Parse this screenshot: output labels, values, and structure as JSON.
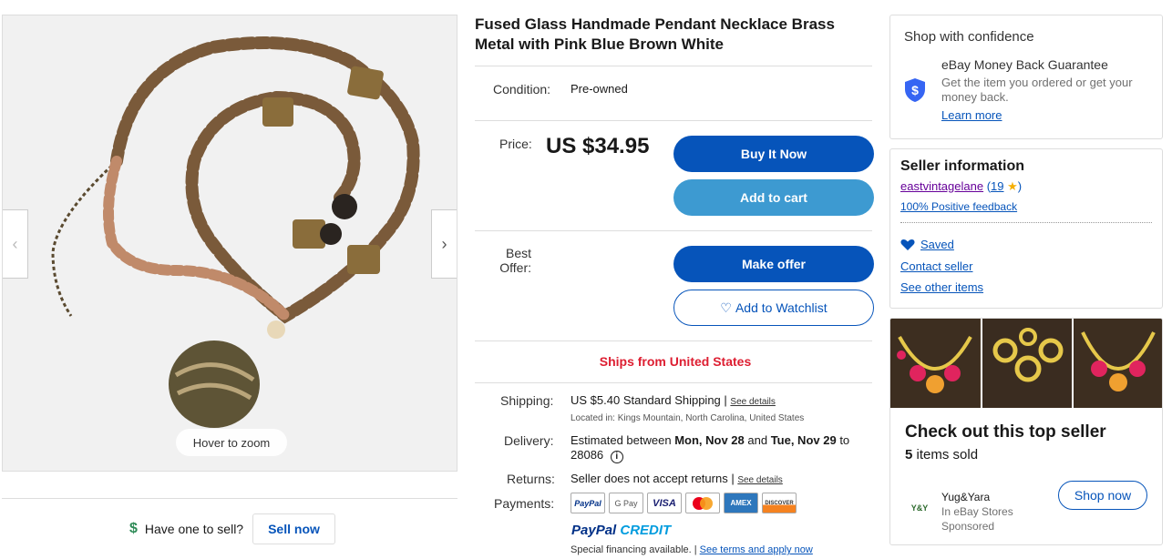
{
  "gallery": {
    "zoom_hint": "Hover to zoom",
    "prev_icon": "chevron-left-icon",
    "next_icon": "chevron-right-icon"
  },
  "sell": {
    "icon": "dollar-icon",
    "prompt": "Have one to sell?",
    "button": "Sell now"
  },
  "listing": {
    "title": "Fused Glass Handmade Pendant Necklace Brass Metal with Pink Blue Brown White",
    "condition_label": "Condition:",
    "condition_value": "Pre-owned",
    "price_label": "Price:",
    "price_value": "US $34.95",
    "buy_now": "Buy It Now",
    "add_to_cart": "Add to cart",
    "best_offer_label_1": "Best",
    "best_offer_label_2": "Offer:",
    "make_offer": "Make offer",
    "add_to_watchlist": "Add to Watchlist",
    "ships_from": "Ships from United States",
    "shipping_label": "Shipping:",
    "shipping_value": "US $5.40 Standard Shipping",
    "shipping_sep": " | ",
    "see_details": "See details",
    "location": "Located in: Kings Mountain, North Carolina, United States",
    "delivery_label": "Delivery:",
    "delivery_prefix": "Estimated between ",
    "delivery_start": "Mon, Nov 28",
    "delivery_and": " and ",
    "delivery_end": "Tue, Nov 29",
    "delivery_to": " to",
    "delivery_zip": "28086",
    "returns_label": "Returns:",
    "returns_value": "Seller does not accept returns",
    "returns_sep": " | ",
    "returns_details": "See details",
    "payments_label": "Payments:",
    "payment_methods": [
      "PayPal",
      "G Pay",
      "VISA",
      "Mastercard",
      "AMEX",
      "DISCOVER"
    ],
    "paypal_credit_1": "PayPal ",
    "paypal_credit_2": "CREDIT",
    "special_financing": "Special financing available. | ",
    "special_link": "See terms and apply now"
  },
  "confidence": {
    "title": "Shop with confidence",
    "heading": "eBay Money Back Guarantee",
    "text": "Get the item you ordered or get your money back.",
    "link": "Learn more"
  },
  "seller": {
    "heading": "Seller information",
    "name": "eastvintagelane",
    "score_open": " (",
    "score": "19",
    "score_close": ")",
    "feedback": "100% Positive feedback",
    "saved": "Saved",
    "contact": "Contact seller",
    "other_items": "See other items"
  },
  "ad": {
    "heading": "Check out this top seller",
    "sold_count": "5",
    "sold_text": " items sold",
    "store_logo_text": "Y&Y",
    "store_name": "Yug&Yara",
    "store_type": "In eBay Stores",
    "sponsored": "Sponsored",
    "button": "Shop now"
  },
  "colors": {
    "primary_blue": "#0654ba",
    "cart_blue": "#3d9ad1",
    "ships_red": "#dd1e31",
    "seller_purple": "#660099"
  }
}
